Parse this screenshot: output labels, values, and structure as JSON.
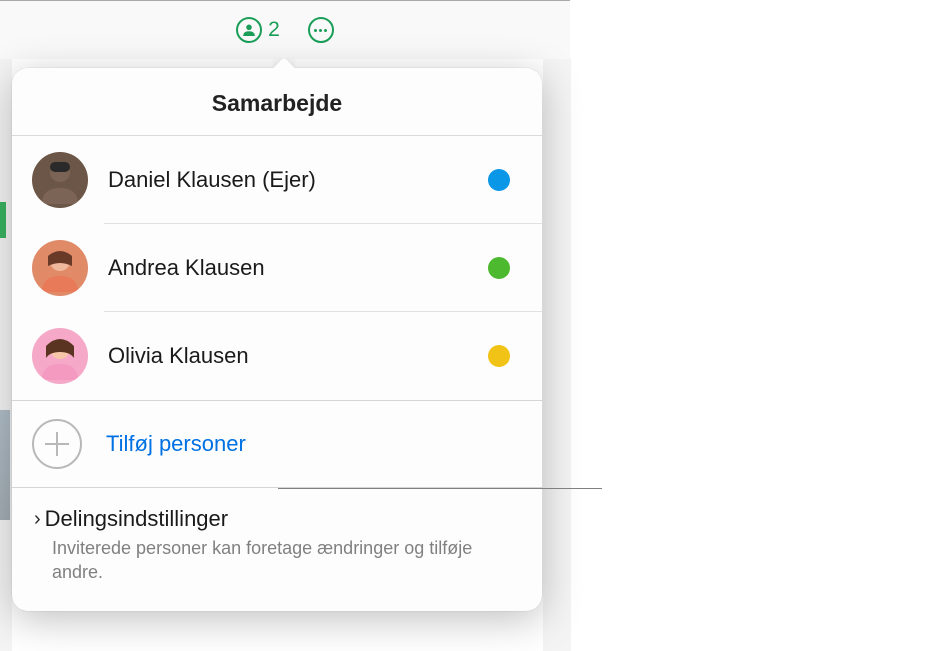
{
  "toolbar": {
    "participant_count": "2",
    "accent_color": "#1a9e58"
  },
  "popover": {
    "title": "Samarbejde",
    "participants": [
      {
        "name": "Daniel Klausen (Ejer)",
        "status_color": "#0a97e8",
        "avatar_bg": "#6b5648"
      },
      {
        "name": "Andrea Klausen",
        "status_color": "#4db92f",
        "avatar_bg": "#e08a68"
      },
      {
        "name": "Olivia Klausen",
        "status_color": "#f0c316",
        "avatar_bg": "#f5a8c8"
      }
    ],
    "add_label": "Tilføj personer",
    "settings": {
      "title": "Delingsindstillinger",
      "subtitle": "Inviterede personer kan foretage ændringer og tilføje andre."
    }
  }
}
